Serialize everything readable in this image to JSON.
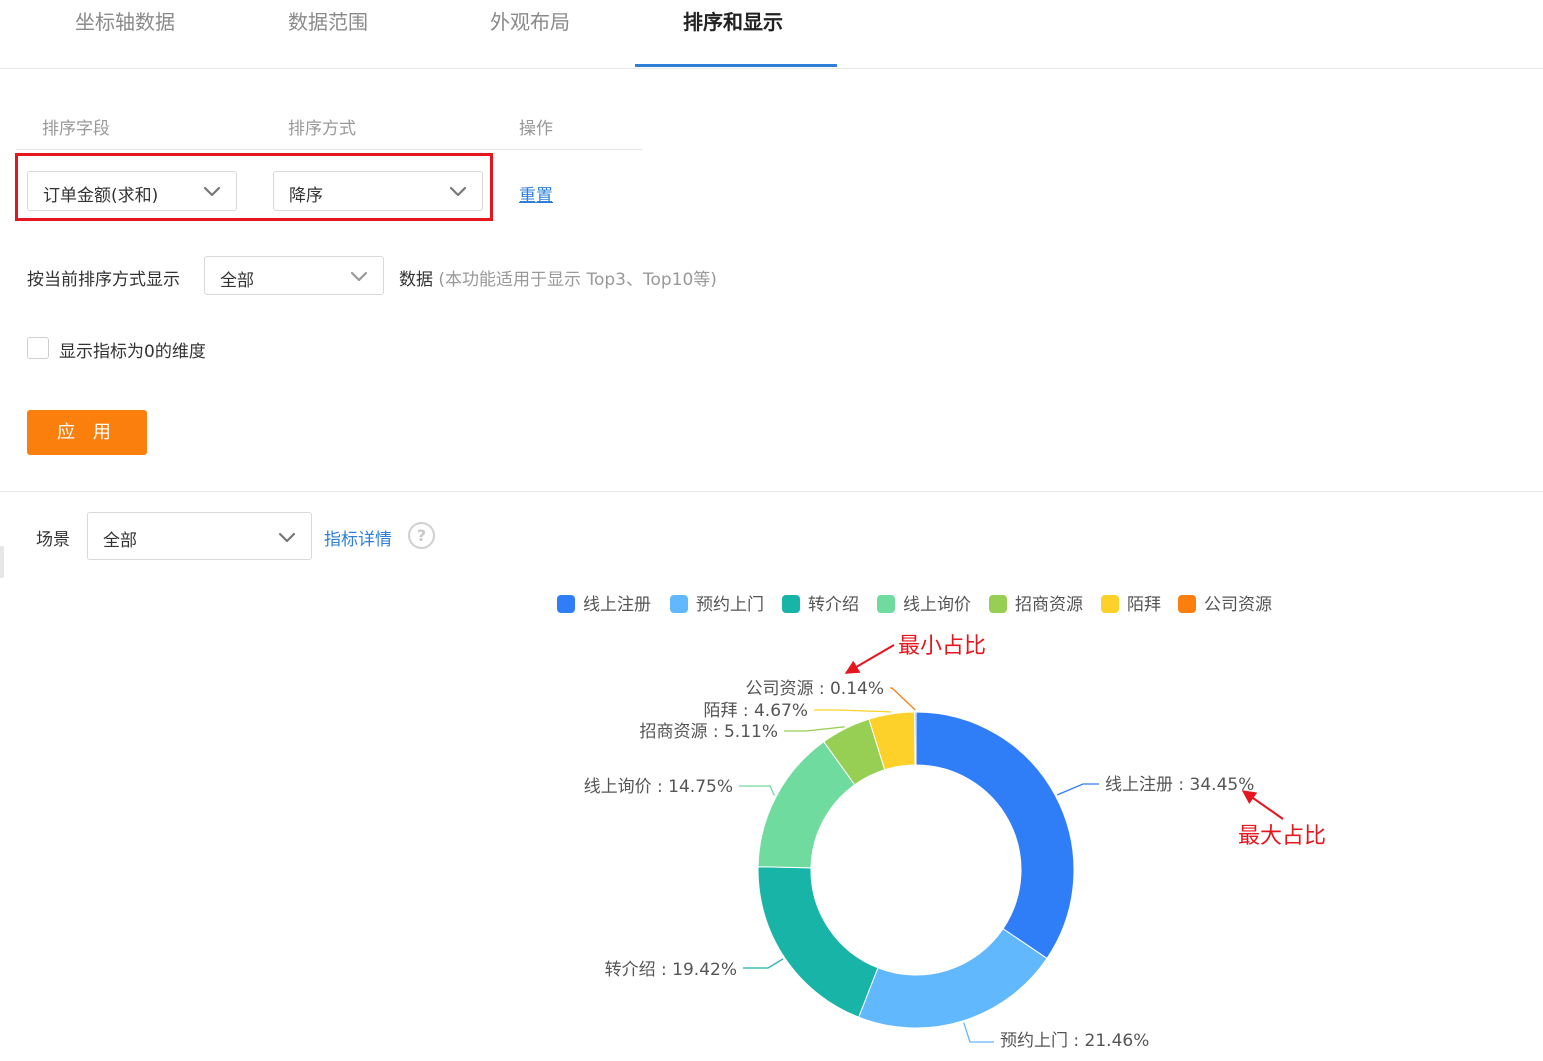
{
  "tabs": [
    {
      "label": "坐标轴数据"
    },
    {
      "label": "数据范围"
    },
    {
      "label": "外观布局"
    },
    {
      "label": "排序和显示"
    }
  ],
  "sort_table": {
    "headers": [
      "排序字段",
      "排序方式",
      "操作"
    ],
    "field_value": "订单金额(求和)",
    "order_value": "降序",
    "reset_label": "重置"
  },
  "display": {
    "prefix": "按当前排序方式显示",
    "value": "全部",
    "suffix": "数据",
    "hint": "(本功能适用于显示 Top3、Top10等)"
  },
  "checkbox_label": "显示指标为0的维度",
  "apply_label": "应 用",
  "scene": {
    "label": "场景",
    "value": "全部",
    "link": "指标详情",
    "help_symbol": "?"
  },
  "annotations": {
    "min": "最小占比",
    "max": "最大占比",
    "color": "#e5161e"
  },
  "chart_data": {
    "type": "pie",
    "donut": true,
    "legend_position": "top",
    "categories": [
      "线上注册",
      "预约上门",
      "转介绍",
      "线上询价",
      "招商资源",
      "陌拜",
      "公司资源"
    ],
    "values": [
      34.45,
      21.46,
      19.42,
      14.75,
      5.11,
      4.67,
      0.14
    ],
    "unit": "%",
    "colors": [
      "#2f7ef8",
      "#62b8fc",
      "#18b4a8",
      "#6fdb9e",
      "#97cf55",
      "#fdd02a",
      "#fb7f0d"
    ],
    "data_labels": [
      "线上注册 : 34.45%",
      "预约上门 : 21.46%",
      "转介绍 : 19.42%",
      "线上询价 : 14.75%",
      "招商资源 : 5.11%",
      "陌拜 : 4.67%",
      "公司资源 : 0.14%"
    ]
  }
}
